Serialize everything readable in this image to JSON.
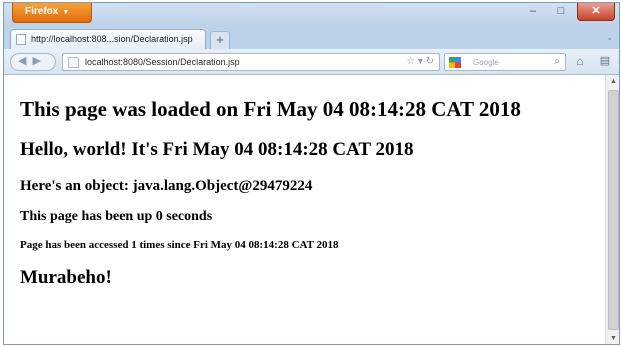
{
  "browser": {
    "app_menu_label": "Firefox",
    "tab_title": "http://localhost:808...sion/Declaration.jsp",
    "new_tab_label": "+",
    "url": "localhost:8080/Session/Declaration.jsp",
    "search_engine": "Google"
  },
  "page": {
    "loaded_line": "This page was loaded on Fri May 04 08:14:28 CAT 2018",
    "hello_line": "Hello, world! It's Fri May 04 08:14:28 CAT 2018",
    "object_line": "Here's an object: java.lang.Object@29479224",
    "uptime_line": "This page has been up 0 seconds",
    "access_line": "Page has been accessed 1 times since Fri May 04 08:14:28 CAT 2018",
    "greeting": "Murabeho!"
  }
}
